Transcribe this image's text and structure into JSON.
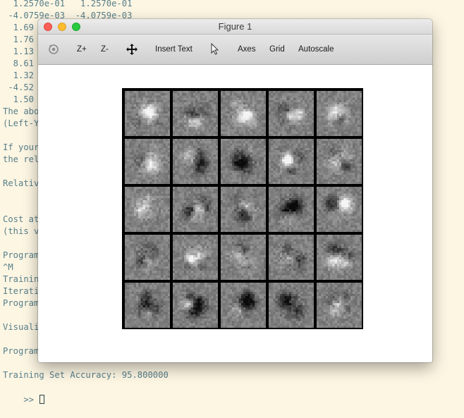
{
  "terminal": {
    "lines": [
      "  1.2570e-01   1.2570e-01",
      " -4.0759e-03  -4.0759e-03",
      "  1.69",
      "  1.76",
      "  1.13",
      "  8.61",
      "  1.32",
      " -4.52",
      "  1.50",
      "The abo",
      "(Left-Y",
      "",
      "If your",
      "the rel",
      "",
      "Relativ",
      "",
      "",
      "Cost at",
      "(this v",
      "",
      "Program",
      "^M",
      "Trainin",
      "Iterati",
      "Program",
      "",
      "Visuali",
      "",
      "Program",
      "",
      "Training Set Accuracy: 95.800000"
    ],
    "prompt": ">> "
  },
  "window": {
    "title": "Figure 1"
  },
  "toolbar": {
    "rotate_icon": "rotate-icon",
    "zoom_in_label": "Z+",
    "zoom_out_label": "Z-",
    "pan_icon": "pan-icon",
    "insert_text_label": "Insert Text",
    "select_icon": "pointer-icon",
    "axes_label": "Axes",
    "grid_label": "Grid",
    "autoscale_label": "Autoscale"
  },
  "figure": {
    "rows": 5,
    "cols": 5,
    "tile_pixels": 20,
    "background": "#000000"
  },
  "colors": {
    "terminal_bg": "#fdf6e3",
    "terminal_text": "#587f8a",
    "close": "#fc5f57",
    "minimize": "#fdbc2e",
    "maximize": "#29c940"
  }
}
